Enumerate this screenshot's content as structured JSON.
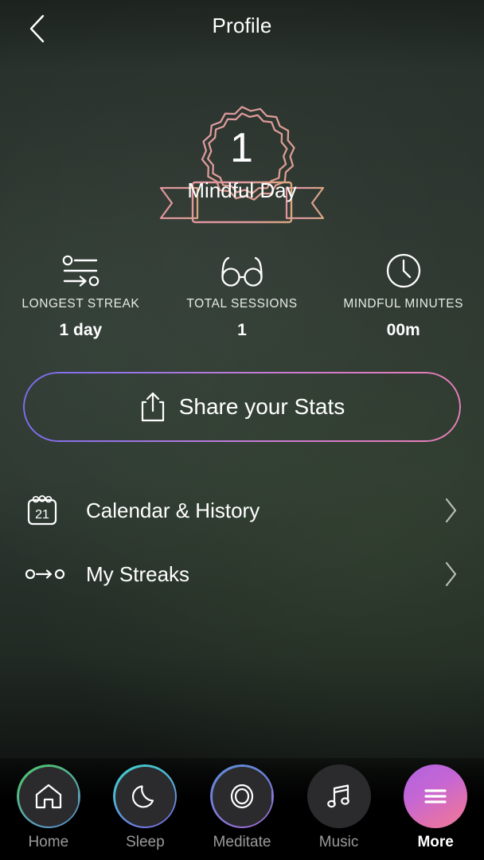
{
  "header": {
    "title": "Profile",
    "back_icon": "chevron-left-icon"
  },
  "badge": {
    "count": "1",
    "ribbon_label": "Mindful Day",
    "badge_color": "#e2969e",
    "ribbon_color_start": "#e2969e",
    "ribbon_color_end": "#d8a87e"
  },
  "stats": [
    {
      "icon": "streak-icon",
      "label": "LONGEST STREAK",
      "value": "1 day"
    },
    {
      "icon": "glasses-icon",
      "label": "TOTAL SESSIONS",
      "value": "1"
    },
    {
      "icon": "clock-icon",
      "label": "MINDFUL MINUTES",
      "value": "00m"
    }
  ],
  "share": {
    "label": "Share your Stats",
    "icon": "share-upload-icon",
    "gradient_start": "#7b6cf0",
    "gradient_end": "#e87fb7"
  },
  "rows": [
    {
      "icon": "calendar-icon",
      "label": "Calendar & History",
      "chevron": "chevron-right-icon",
      "calendar_day": "21"
    },
    {
      "icon": "streak-dots-icon",
      "label": "My Streaks",
      "chevron": "chevron-right-icon"
    }
  ],
  "nav": {
    "items": [
      {
        "label": "Home",
        "icon": "home-icon",
        "active": false,
        "ring_start": "#4fbf7a",
        "ring_end": "#5b8fd6"
      },
      {
        "label": "Sleep",
        "icon": "moon-icon",
        "active": false,
        "ring_start": "#3fd0c9",
        "ring_end": "#7a64e0"
      },
      {
        "label": "Meditate",
        "icon": "rings-icon",
        "active": false,
        "ring_start": "#5b8fd6",
        "ring_end": "#a367d8"
      },
      {
        "label": "Music",
        "icon": "music-icon",
        "active": false,
        "ring_start": "#8f6ee6",
        "ring_end": "#e06bab"
      },
      {
        "label": "More",
        "icon": "hamburger-icon",
        "active": true,
        "ring_start": "#b163e0",
        "ring_end": "#f07a9a"
      }
    ]
  }
}
